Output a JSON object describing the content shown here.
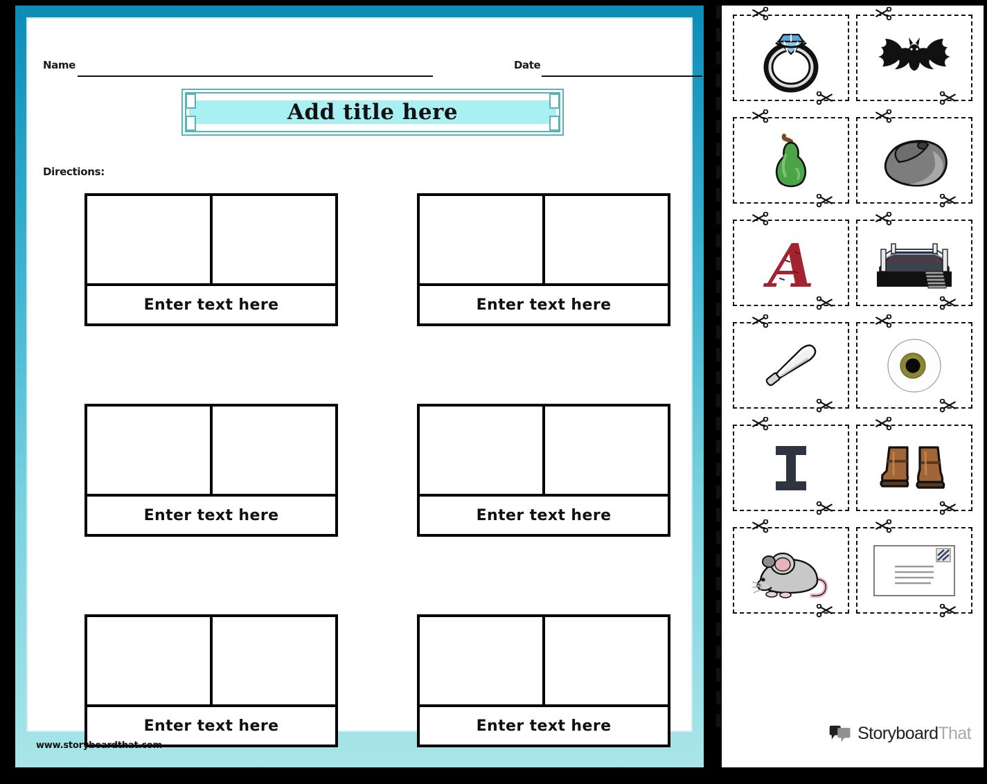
{
  "worksheet": {
    "name_label": "Name",
    "date_label": "Date",
    "name_value": "",
    "date_value": "",
    "title": "Add title here",
    "directions_label": "Directions:",
    "footer_url": "www.storyboardthat.com",
    "cells": [
      {
        "label": "Enter text here"
      },
      {
        "label": "Enter text here"
      },
      {
        "label": "Enter text here"
      },
      {
        "label": "Enter text here"
      },
      {
        "label": "Enter text here"
      },
      {
        "label": "Enter text here"
      }
    ]
  },
  "cut_panel": {
    "cut_line_icon": "scissors-icon",
    "cards": [
      {
        "icon": "ring-icon",
        "alt": "diamond ring"
      },
      {
        "icon": "bat-icon",
        "alt": "bat"
      },
      {
        "icon": "pear-icon",
        "alt": "pear"
      },
      {
        "icon": "computer-mouse-icon",
        "alt": "computer mouse"
      },
      {
        "icon": "letter-a-icon",
        "alt": "letter A"
      },
      {
        "icon": "boxing-ring-icon",
        "alt": "boxing ring"
      },
      {
        "icon": "baseball-bat-icon",
        "alt": "baseball bat"
      },
      {
        "icon": "eye-icon",
        "alt": "eye"
      },
      {
        "icon": "letter-i-icon",
        "alt": "letter I"
      },
      {
        "icon": "boots-icon",
        "alt": "boots"
      },
      {
        "icon": "mouse-animal-icon",
        "alt": "mouse"
      },
      {
        "icon": "postcard-icon",
        "alt": "postcard"
      }
    ]
  },
  "brand": {
    "name_dark": "Storyboard",
    "name_light": "That"
  },
  "colors": {
    "border_top": "#0c8cb6",
    "border_bottom": "#a9e5e9",
    "title_fill": "#a9f0f2",
    "title_border": "#57b5b7",
    "ink": "#111111"
  }
}
